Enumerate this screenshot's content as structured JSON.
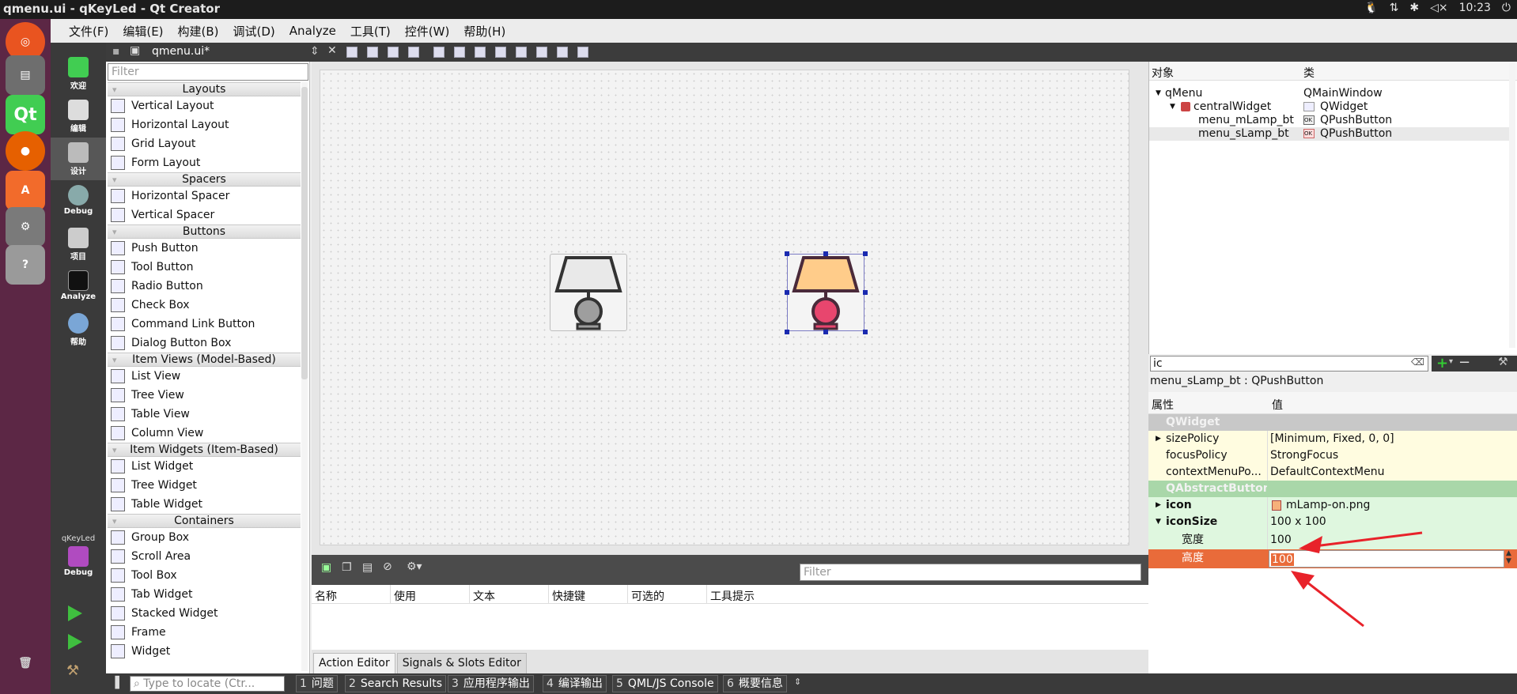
{
  "window": {
    "title": "qmenu.ui - qKeyLed - Qt Creator",
    "clock": "10:23"
  },
  "menu": [
    "文件(F)",
    "编辑(E)",
    "构建(B)",
    "调试(D)",
    "Analyze",
    "工具(T)",
    "控件(W)",
    "帮助(H)"
  ],
  "modes": [
    {
      "label": "欢迎",
      "icon": "qt-logo-icon"
    },
    {
      "label": "编辑",
      "icon": "document-icon"
    },
    {
      "label": "设计",
      "icon": "pencil-icon"
    },
    {
      "label": "Debug",
      "icon": "bug-icon"
    },
    {
      "label": "项目",
      "icon": "wrench-icon"
    },
    {
      "label": "Analyze",
      "icon": "monitor-icon"
    },
    {
      "label": "帮助",
      "icon": "question-icon"
    }
  ],
  "kit": {
    "project": "qKeyLed",
    "mode": "Debug"
  },
  "editor": {
    "file_name": "qmenu.ui*"
  },
  "widget_box": {
    "filter_placeholder": "Filter",
    "sections": [
      {
        "title": "Layouts",
        "items": [
          "Vertical Layout",
          "Horizontal Layout",
          "Grid Layout",
          "Form Layout"
        ]
      },
      {
        "title": "Spacers",
        "items": [
          "Horizontal Spacer",
          "Vertical Spacer"
        ]
      },
      {
        "title": "Buttons",
        "items": [
          "Push Button",
          "Tool Button",
          "Radio Button",
          "Check Box",
          "Command Link Button",
          "Dialog Button Box"
        ]
      },
      {
        "title": "Item Views (Model-Based)",
        "items": [
          "List View",
          "Tree View",
          "Table View",
          "Column View"
        ]
      },
      {
        "title": "Item Widgets (Item-Based)",
        "items": [
          "List Widget",
          "Tree Widget",
          "Table Widget"
        ]
      },
      {
        "title": "Containers",
        "items": [
          "Group Box",
          "Scroll Area",
          "Tool Box",
          "Tab Widget",
          "Stacked Widget",
          "Frame",
          "Widget"
        ]
      }
    ]
  },
  "action_editor": {
    "filter_placeholder": "Filter",
    "columns": [
      "名称",
      "使用",
      "文本",
      "快捷键",
      "可选的",
      "工具提示"
    ],
    "tabs": [
      "Action Editor",
      "Signals & Slots Editor"
    ]
  },
  "object_inspector": {
    "columns": [
      "对象",
      "类"
    ],
    "rows": [
      {
        "name": "qMenu",
        "class": "QMainWindow"
      },
      {
        "name": "centralWidget",
        "class": "QWidget"
      },
      {
        "name": "menu_mLamp_bt",
        "class": "QPushButton"
      },
      {
        "name": "menu_sLamp_bt",
        "class": "QPushButton"
      }
    ]
  },
  "property_editor": {
    "search_value": "ic",
    "object_label": "menu_sLamp_bt : QPushButton",
    "columns": [
      "属性",
      "值"
    ],
    "groups": [
      {
        "name": "QWidget",
        "props": [
          {
            "name": "sizePolicy",
            "value": "[Minimum, Fixed, 0, 0]"
          },
          {
            "name": "focusPolicy",
            "value": "StrongFocus"
          },
          {
            "name": "contextMenuPo...",
            "value": "DefaultContextMenu"
          }
        ]
      },
      {
        "name": "QAbstractButton",
        "props": [
          {
            "name": "icon",
            "value": "mLamp-on.png"
          },
          {
            "name": "iconSize",
            "value": "100 x 100"
          },
          {
            "name": "宽度",
            "value": "100"
          },
          {
            "name": "高度",
            "value": "100"
          }
        ]
      }
    ]
  },
  "status_bar": {
    "locate_placeholder": "Type to locate (Ctr...",
    "tabs": [
      {
        "num": "1",
        "label": "问题"
      },
      {
        "num": "2",
        "label": "Search Results"
      },
      {
        "num": "3",
        "label": "应用程序输出"
      },
      {
        "num": "4",
        "label": "编译输出"
      },
      {
        "num": "5",
        "label": "QML/JS Console"
      },
      {
        "num": "6",
        "label": "概要信息"
      }
    ]
  },
  "colors": {
    "accent_orange": "#e96b3a",
    "arrow_red": "#e8222a",
    "lamp_on_shade": "#ffcc8a",
    "lamp_on_base": "#e8466e"
  }
}
